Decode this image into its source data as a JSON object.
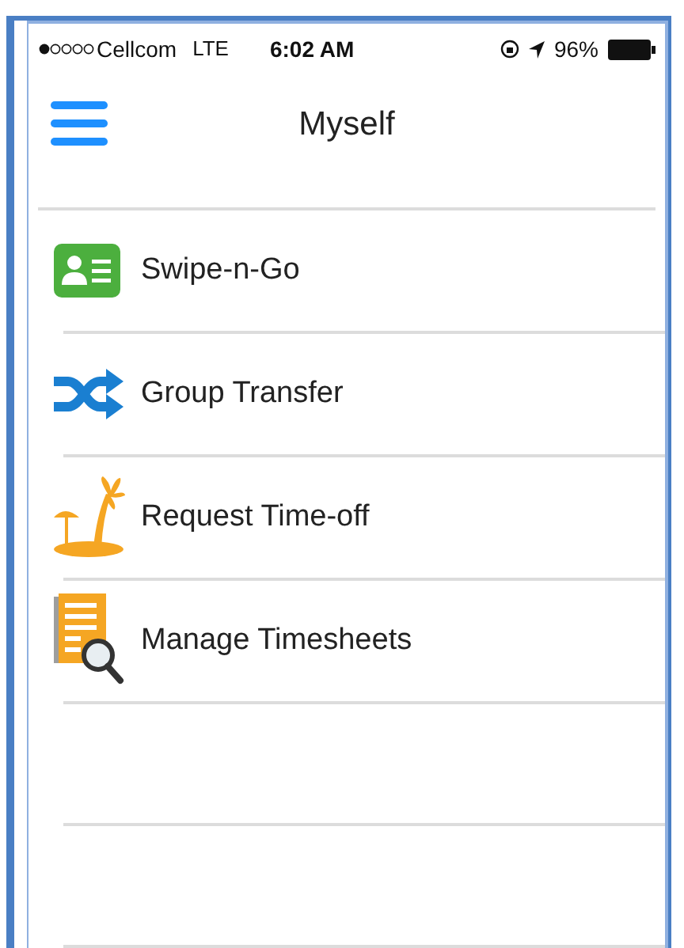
{
  "status_bar": {
    "carrier": "Cellcom",
    "network": "LTE",
    "time": "6:02 AM",
    "battery": "96%"
  },
  "header": {
    "title": "Myself"
  },
  "menu_items": [
    {
      "kind": "card",
      "label": "Swipe-n-Go"
    },
    {
      "kind": "shuffle",
      "label": "Group Transfer"
    },
    {
      "kind": "island",
      "label": "Request Time-off"
    },
    {
      "kind": "timesheet",
      "label": "Manage Timesheets"
    }
  ]
}
